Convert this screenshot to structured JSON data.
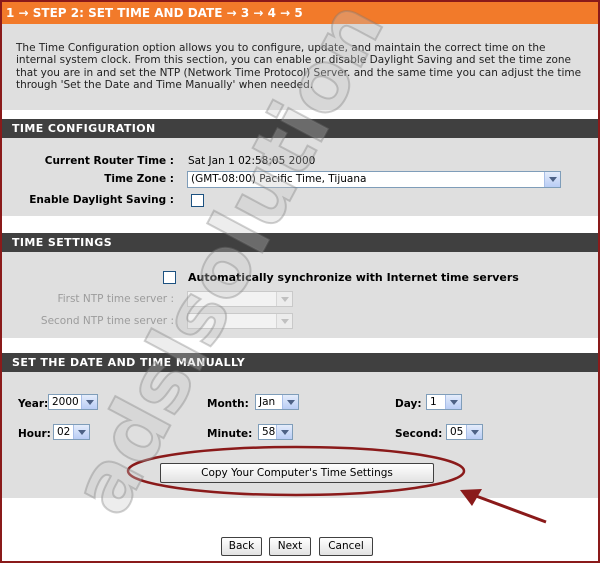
{
  "header": {
    "title": "1 → STEP 2: SET TIME AND DATE → 3 → 4 → 5"
  },
  "intro": {
    "text": "The Time Configuration option allows you to configure, update, and maintain the correct time on the internal system clock. From this section, you can enable or disable Daylight Saving and set the time zone that you are in and set the NTP (Network Time Protocol) Server. and the same time you can adjust the time through 'Set the Date and Time Manually' when needed."
  },
  "time_config": {
    "heading": "TIME CONFIGURATION",
    "current_time_label": "Current Router Time :",
    "current_time_value": "Sat Jan 1 02:58:05 2000",
    "timezone_label": "Time Zone :",
    "timezone_value": "(GMT-08:00) Pacific Time, Tijuana",
    "daylight_label": "Enable Daylight Saving :",
    "daylight_checked": false
  },
  "time_settings": {
    "heading": "TIME SETTINGS",
    "auto_sync_label": "Automatically synchronize with Internet time servers",
    "auto_sync_checked": false,
    "ntp1_label": "First NTP time server :",
    "ntp1_value": "",
    "ntp2_label": "Second NTP time server :",
    "ntp2_value": ""
  },
  "manual": {
    "heading": "SET THE DATE AND TIME MANUALLY",
    "year_label": "Year:",
    "year_value": "2000",
    "month_label": "Month:",
    "month_value": "Jan",
    "day_label": "Day:",
    "day_value": "1",
    "hour_label": "Hour:",
    "hour_value": "02",
    "minute_label": "Minute:",
    "minute_value": "58",
    "second_label": "Second:",
    "second_value": "05",
    "copy_button": "Copy Your Computer's Time Settings"
  },
  "nav": {
    "back": "Back",
    "next": "Next",
    "cancel": "Cancel"
  },
  "watermark": {
    "text": "adslsolution"
  },
  "colors": {
    "header": "#f27a2a",
    "section": "#404040",
    "panel": "#dfdfdf",
    "annotation": "#8a1a1a"
  }
}
